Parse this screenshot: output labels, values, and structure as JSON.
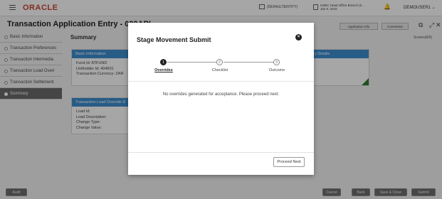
{
  "topbar": {
    "logo": "ORACLE",
    "entity": "(DEFAULTENTITY)",
    "branch_line1": "HSBC Head Office Branch (0...",
    "branch_line2": "Jan 6, 2016",
    "user": "DEMOUSER1"
  },
  "header": {
    "title": "Transaction Application Entry - 000API",
    "btn_application_info": "Application Info",
    "btn_comments": "Comments",
    "screen_count": "Screen(6/6)"
  },
  "sidebar": {
    "items": [
      {
        "label": "Basic Information"
      },
      {
        "label": "Transaction Preferences"
      },
      {
        "label": "Transaction Intermedia"
      },
      {
        "label": "Transaction Load Overr"
      },
      {
        "label": "Transaction Settlement"
      },
      {
        "label": "Summary"
      }
    ]
  },
  "main": {
    "summary_title": "Summary",
    "basic_info": {
      "head": "Basic Information",
      "fund_id": "Fund Id: ATFUND",
      "unitholder_id": "Unitholder Id: 404601",
      "currency": "Transaction Currency: ZAR"
    },
    "load_override": {
      "head": "Transaction Load Override D",
      "load_id": "Load Id:",
      "load_desc": "Load Description:",
      "change_type": "Change Type:",
      "change_value": "Change Value:"
    },
    "right_card": {
      "head": "ndary Details"
    }
  },
  "modal": {
    "title": "Stage Movement Submit",
    "close_icon": "close-icon",
    "steps": [
      {
        "num": "1",
        "label": "Overrides"
      },
      {
        "num": "2",
        "label": "Checklist"
      },
      {
        "num": "3",
        "label": "Outcome"
      }
    ],
    "message": "No overrides generated for acceptance. Please proceed next.",
    "proceed_label": "Proceed Next"
  },
  "footer": {
    "audit": "Audit",
    "cancel": "Cancel",
    "back": "Back",
    "save_close": "Save & Close",
    "submit": "Submit"
  },
  "colors": {
    "brand": "#c74634",
    "card_head": "#3d8ed0",
    "active_sidebar": "#6b6b6b"
  }
}
